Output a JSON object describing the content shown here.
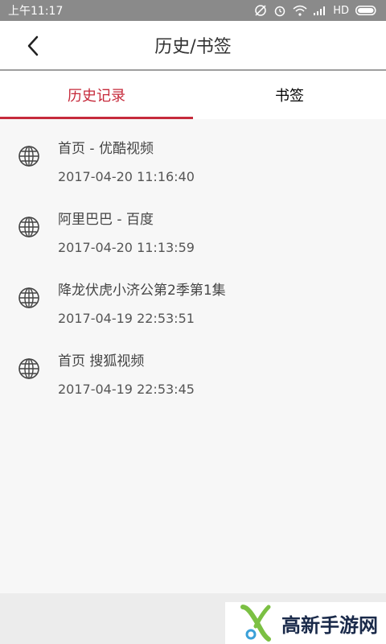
{
  "status_bar": {
    "time": "上午11:17",
    "network": "HD"
  },
  "header": {
    "title": "历史/书签"
  },
  "tabs": [
    {
      "label": "历史记录",
      "active": true
    },
    {
      "label": "书签",
      "active": false
    }
  ],
  "history": [
    {
      "title": "首页 - 优酷视频",
      "time": "2017-04-20 11:16:40"
    },
    {
      "title": "阿里巴巴 - 百度",
      "time": "2017-04-20 11:13:59"
    },
    {
      "title": "降龙伏虎小济公第2季第1集",
      "time": "2017-04-19 22:53:51"
    },
    {
      "title": "首页 搜狐视频",
      "time": "2017-04-19 22:53:45"
    }
  ],
  "watermark": {
    "text": "高新手游网"
  },
  "colors": {
    "accent": "#c62a3b",
    "status_bar": "#8a8a8a"
  },
  "icons": {
    "back": "chevron-left-icon",
    "item": "globe-icon",
    "logo": "logo-icon"
  }
}
